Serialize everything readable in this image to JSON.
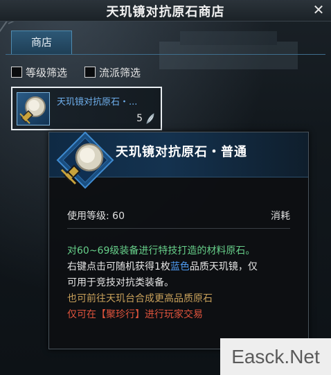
{
  "window": {
    "title": "天玑镜对抗原石商店"
  },
  "tabs": [
    {
      "label": "商店",
      "active": true
    }
  ],
  "filters": [
    {
      "label": "等级筛选",
      "checked": false
    },
    {
      "label": "流派筛选",
      "checked": false
    }
  ],
  "item": {
    "name": "天玑镜对抗原石・...",
    "price": "5",
    "icon": "crystal-ball-icon",
    "currency_icon": "feather-icon"
  },
  "tooltip": {
    "title": "天玑镜对抗原石・普通",
    "level_label": "使用等级: 60",
    "type": "消耗",
    "desc": {
      "line1": "对60~69级装备进行特技打造的材料原石。",
      "line2_pre": "右键点击可随机获得1枚",
      "line2_blue": "蓝色",
      "line2_post": "品质天玑镜，仅",
      "line3": "可用于竞技对抗类装备。",
      "line4": "也可前往天玑台合成更高品质原石",
      "line5": "仅可在【聚珍行】进行玩家交易"
    }
  },
  "watermark": "Easck.Net",
  "colors": {
    "item_name": "#6fb0ee",
    "green_text": "#67d08a",
    "blue_text": "#4e9bf2",
    "gold_text": "#c8a05a",
    "red_text": "#e0533c"
  }
}
